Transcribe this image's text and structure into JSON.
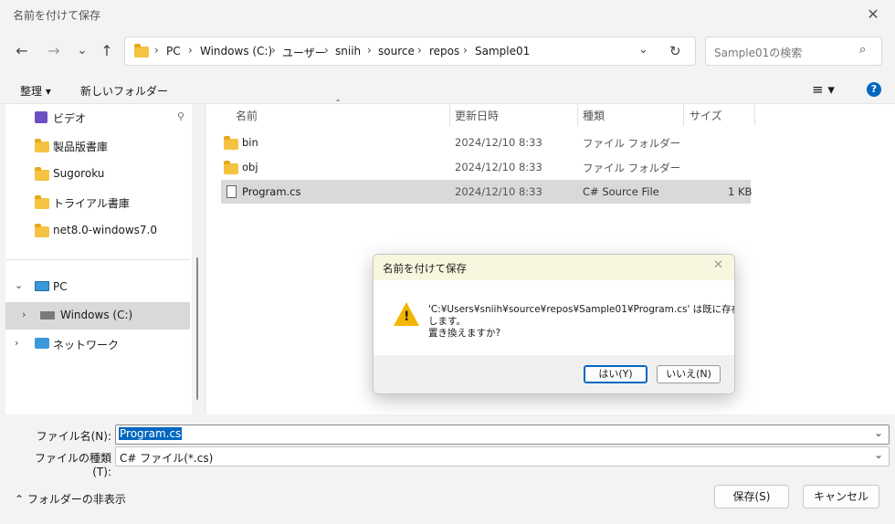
{
  "window": {
    "title": "名前を付けて保存"
  },
  "nav": {
    "back": "←",
    "forward": "→",
    "recent": "⌄",
    "up": "↑",
    "breadcrumb": [
      "PC",
      "Windows (C:)",
      "ユーザー",
      "sniih",
      "source",
      "repos",
      "Sample01"
    ],
    "search_placeholder": "Sample01の検索"
  },
  "toolbar": {
    "organize": "整理 ▾",
    "new_folder": "新しいフォルダー"
  },
  "sidebar": {
    "items": [
      {
        "label": "ビデオ",
        "icon": "video-icon"
      },
      {
        "label": "製品版書庫",
        "icon": "folder-icon"
      },
      {
        "label": "Sugoroku",
        "icon": "folder-icon"
      },
      {
        "label": "トライアル書庫",
        "icon": "folder-icon"
      },
      {
        "label": "net8.0-windows7.0",
        "icon": "folder-icon"
      },
      {
        "label": "PC",
        "icon": "pc-icon"
      },
      {
        "label": "Windows (C:)",
        "icon": "drive-icon"
      },
      {
        "label": "ネットワーク",
        "icon": "network-icon"
      }
    ]
  },
  "files": {
    "columns": [
      "名前",
      "更新日時",
      "種類",
      "サイズ"
    ],
    "rows": [
      {
        "name": "bin",
        "date": "2024/12/10 8:33",
        "type": "ファイル フォルダー",
        "size": ""
      },
      {
        "name": "obj",
        "date": "2024/12/10 8:33",
        "type": "ファイル フォルダー",
        "size": ""
      },
      {
        "name": "Program.cs",
        "date": "2024/12/10 8:33",
        "type": "C# Source File",
        "size": "1 KB"
      }
    ]
  },
  "form": {
    "filename_label": "ファイル名(N):",
    "filename_value": "Program.cs",
    "filetype_label": "ファイルの種類(T):",
    "filetype_value": "C# ファイル(*.cs)",
    "hide_folders": "フォルダーの非表示",
    "save": "保存(S)",
    "cancel": "キャンセル"
  },
  "dialog": {
    "title": "名前を付けて保存",
    "message_line1": "'C:¥Users¥sniih¥source¥repos¥Sample01¥Program.cs' は既に存在",
    "message_line2": "します。",
    "message_line3": "置き換えますか?",
    "yes": "はい(Y)",
    "no": "いいえ(N)"
  },
  "colors": {
    "accent": "#0067c0",
    "selection": "#d9d9d9",
    "dialog_title_bg": "#f7f6de"
  }
}
